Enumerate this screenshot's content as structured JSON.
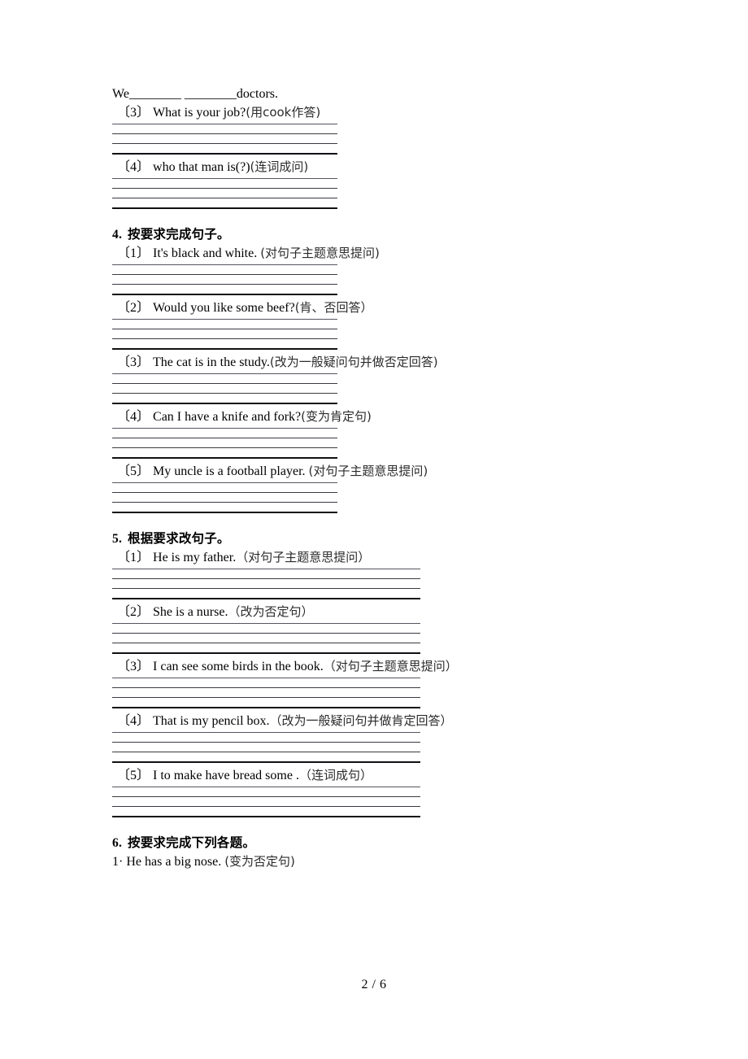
{
  "document": {
    "page_label": "2 / 6"
  },
  "top_fragment": {
    "fill_in_line": "We________ ________doctors.",
    "items": [
      {
        "marker": "〔3〕",
        "english": "What is your job?",
        "chinese": "(用cook作答)"
      },
      {
        "marker": "〔4〕",
        "english": "who that man is(?)",
        "chinese": "(连词成问)"
      }
    ]
  },
  "sections": [
    {
      "number": "4.",
      "title": "按要求完成句子。",
      "line_width": "narrow",
      "items": [
        {
          "marker": "〔1〕",
          "english": "It's black and white. ",
          "chinese": "(对句子主题意思提问)"
        },
        {
          "marker": "〔2〕",
          "english": "Would you like some beef?",
          "chinese": "(肯、否回答）"
        },
        {
          "marker": "〔3〕",
          "english": "The cat is in the study.",
          "chinese": "(改为一般疑问句并做否定回答)"
        },
        {
          "marker": "〔4〕",
          "english": "Can I have a knife and fork?",
          "chinese": "(变为肯定句)"
        },
        {
          "marker": "〔5〕",
          "english": "My uncle is a football player. ",
          "chinese": "(对句子主题意思提问)"
        }
      ]
    },
    {
      "number": "5.",
      "title": "根据要求改句子。",
      "line_width": "wide",
      "items": [
        {
          "marker": "〔1〕",
          "english": "He is my father.",
          "chinese": "（对句子主题意思提问）"
        },
        {
          "marker": "〔2〕",
          "english": "She is a nurse.",
          "chinese": "（改为否定句）"
        },
        {
          "marker": "〔3〕",
          "english": "I can see some birds in the book.",
          "chinese": "（对句子主题意思提问）"
        },
        {
          "marker": "〔4〕",
          "english": "That is my pencil box.",
          "chinese": "（改为一般疑问句并做肯定回答）"
        },
        {
          "marker": "〔5〕",
          "english": "I to make have bread some .",
          "chinese": "（连词成句）"
        }
      ]
    },
    {
      "number": "6.",
      "title": "按要求完成下列各题。",
      "line_width": "none",
      "items": [
        {
          "marker": "1·",
          "english": "He has a big nose. ",
          "chinese": "(变为否定句)"
        }
      ]
    }
  ]
}
